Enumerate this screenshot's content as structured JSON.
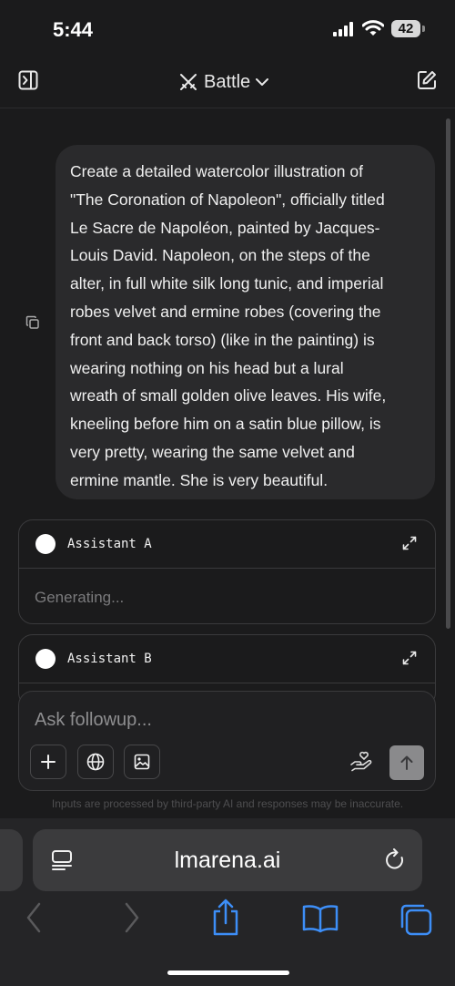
{
  "status_bar": {
    "time": "5:44",
    "battery_level": "42"
  },
  "header": {
    "mode_label": "Battle"
  },
  "prompt": {
    "lines": [
      "Create a detailed watercolor illustration of",
      "\"The Coronation of Napoleon\", officially titled",
      "Le Sacre de Napoléon, painted by Jacques-",
      "Louis David. Napoleon, on the steps of the",
      "alter, in full white silk long tunic, and imperial",
      "robes velvet and ermine robes (covering the",
      "front and back torso) (like in the painting) is",
      "wearing nothing on his head but a lural",
      "wreath of small golden olive leaves. His wife,",
      "kneeling before him on a satin blue pillow, is",
      "very pretty, wearing the same velvet and",
      "ermine mantle. She is very beautiful."
    ]
  },
  "assistant_a": {
    "title": "Assistant A",
    "status": "Generating..."
  },
  "assistant_b": {
    "title": "Assistant B"
  },
  "composer": {
    "placeholder": "Ask followup..."
  },
  "disclaimer": "Inputs are processed by third-party AI and responses may be inaccurate.",
  "browser": {
    "url": "lmarena.ai"
  },
  "icons": {
    "sidebar": "sidebar-toggle-icon",
    "battle": "swords-icon",
    "new_chat": "edit-icon",
    "copy": "copy-icon",
    "expand": "expand-icon",
    "plus": "plus-icon",
    "globe": "globe-icon",
    "image": "image-icon",
    "feedback": "hand-heart-icon",
    "send": "arrow-up-icon",
    "reader": "reader-icon",
    "reload": "reload-icon",
    "back": "chevron-left-icon",
    "forward": "chevron-right-icon",
    "share": "share-icon",
    "bookmarks": "book-icon",
    "tabs": "tabs-icon"
  },
  "colors": {
    "background": "#1b1b1c",
    "accent_safari": "#3d8ef7",
    "send_button": "#8a8a8c"
  }
}
